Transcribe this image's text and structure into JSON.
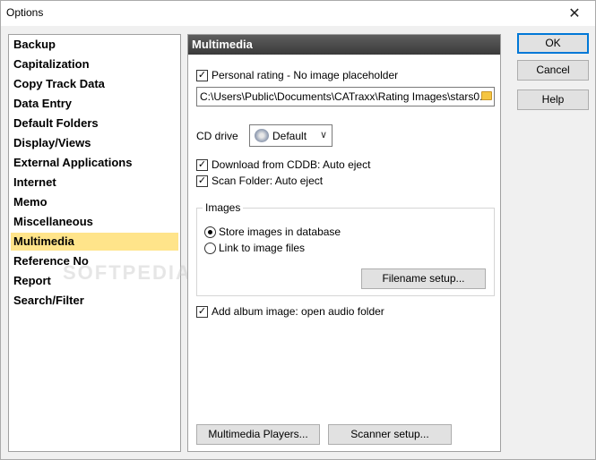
{
  "window": {
    "title": "Options",
    "close_glyph": "✕"
  },
  "categories": [
    "Backup",
    "Capitalization",
    "Copy Track Data",
    "Data Entry",
    "Default Folders",
    "Display/Views",
    "External Applications",
    "Internet",
    "Memo",
    "Miscellaneous",
    "Multimedia",
    "Reference No",
    "Report",
    "Search/Filter"
  ],
  "selected_category": "Multimedia",
  "watermark": "SOFTPEDIA",
  "panel": {
    "header": "Multimedia",
    "personal_rating": {
      "label": "Personal rating - No image placeholder",
      "checked": true
    },
    "rating_path": "C:\\Users\\Public\\Documents\\CATraxx\\Rating Images\\stars0.",
    "cd_drive": {
      "label": "CD drive",
      "value": "Default",
      "icon": "cd-drive-icon"
    },
    "download_cddb": {
      "label": "Download from CDDB: Auto eject",
      "checked": true
    },
    "scan_folder": {
      "label": "Scan Folder: Auto eject",
      "checked": true
    },
    "images_group": {
      "title": "Images",
      "store_db": {
        "label": "Store images in database",
        "selected": true
      },
      "link_files": {
        "label": "Link to image files",
        "selected": false
      },
      "filename_setup": "Filename setup..."
    },
    "add_album_image": {
      "label": "Add album image: open audio folder",
      "checked": true
    },
    "multimedia_players": "Multimedia Players...",
    "scanner_setup": "Scanner setup..."
  },
  "dialog_buttons": {
    "ok": "OK",
    "cancel": "Cancel",
    "help": "Help"
  }
}
